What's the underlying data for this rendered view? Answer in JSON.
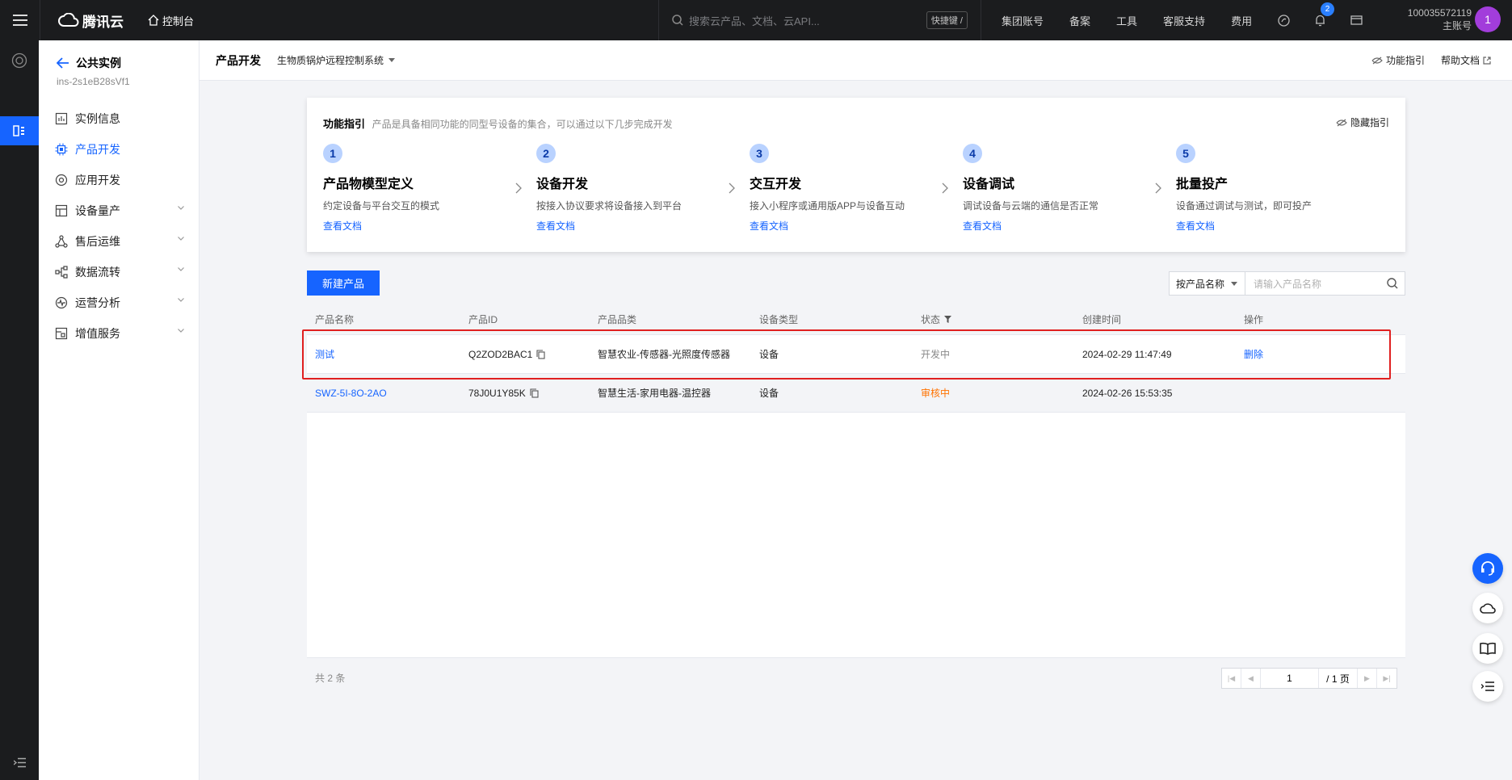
{
  "topbar": {
    "brand": "腾讯云",
    "console": "控制台",
    "search_placeholder": "搜索云产品、文档、云API...",
    "shortcut": "快捷键 /",
    "links": [
      "集团账号",
      "备案",
      "工具",
      "客服支持",
      "费用"
    ],
    "notification_count": "2",
    "account_id": "100035572119",
    "account_type": "主账号",
    "avatar_letter": "1"
  },
  "sidebar": {
    "back_title": "公共实例",
    "instance_id": "ins-2s1eB28sVf1",
    "items": [
      {
        "label": "实例信息"
      },
      {
        "label": "产品开发"
      },
      {
        "label": "应用开发"
      },
      {
        "label": "设备量产"
      },
      {
        "label": "售后运维"
      },
      {
        "label": "数据流转"
      },
      {
        "label": "运营分析"
      },
      {
        "label": "增值服务"
      }
    ]
  },
  "subheader": {
    "title": "产品开发",
    "project": "生物质锅炉远程控制系统",
    "guide_link": "功能指引",
    "help_link": "帮助文档"
  },
  "guide": {
    "title": "功能指引",
    "desc": "产品是具备相同功能的同型号设备的集合，可以通过以下几步完成开发",
    "hide": "隐藏指引",
    "steps": [
      {
        "num": "1",
        "title": "产品物模型定义",
        "desc": "约定设备与平台交互的模式",
        "link": "查看文档"
      },
      {
        "num": "2",
        "title": "设备开发",
        "desc": "按接入协议要求将设备接入到平台",
        "link": "查看文档"
      },
      {
        "num": "3",
        "title": "交互开发",
        "desc": "接入小程序或通用版APP与设备互动",
        "link": "查看文档"
      },
      {
        "num": "4",
        "title": "设备调试",
        "desc": "调试设备与云端的通信是否正常",
        "link": "查看文档"
      },
      {
        "num": "5",
        "title": "批量投产",
        "desc": "设备通过调试与测试，即可投产",
        "link": "查看文档"
      }
    ]
  },
  "toolbar": {
    "new_product": "新建产品",
    "filter_by": "按产品名称",
    "search_placeholder": "请输入产品名称"
  },
  "table": {
    "headers": [
      "产品名称",
      "产品ID",
      "产品品类",
      "设备类型",
      "状态",
      "创建时间",
      "操作"
    ],
    "rows": [
      {
        "name": "测试",
        "id": "Q2ZOD2BAC1",
        "category": "智慧农业-传感器-光照度传感器",
        "type": "设备",
        "status": "开发中",
        "created": "2024-02-29 11:47:49",
        "action": "删除"
      },
      {
        "name": "SWZ-5I-8O-2AO",
        "id": "78J0U1Y85K",
        "category": "智慧生活-家用电器-温控器",
        "type": "设备",
        "status": "审核中",
        "created": "2024-02-26 15:53:35",
        "action": ""
      }
    ]
  },
  "pagination": {
    "total": "共 2 条",
    "page": "1",
    "total_pages": "/ 1 页"
  },
  "colors": {
    "accent": "#1664ff",
    "topbar": "#1b1c1e",
    "status_review": "#ff7200",
    "highlight": "#e02020"
  }
}
